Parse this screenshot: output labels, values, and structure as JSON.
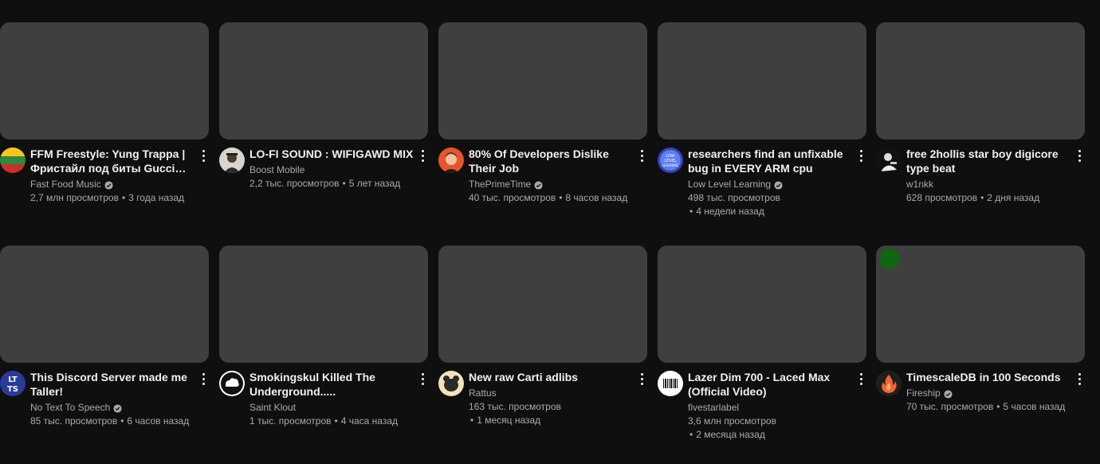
{
  "videos": [
    {
      "title": "FFM Freestyle: Yung Trappa | Фристайл под биты Gucci Man...",
      "channel": "Fast Food Music",
      "verified": true,
      "views": "2,7 млн просмотров",
      "age": "3 года назад",
      "avatar": "flag-stripes-avatar"
    },
    {
      "title": "LO-FI SOUND : WIFIGAWD MIX",
      "channel": "Boost Mobile",
      "verified": false,
      "views": "2,2 тыс. просмотров",
      "age": "5 лет назад",
      "avatar": "person-avatar"
    },
    {
      "title": "80% Of Developers Dislike Their Job",
      "channel": "ThePrimeTime",
      "verified": true,
      "views": "40 тыс. просмотров",
      "age": "8 часов назад",
      "avatar": "face-avatar"
    },
    {
      "title": "researchers find an unfixable bug in EVERY ARM cpu",
      "channel": "Low Level Learning",
      "verified": true,
      "views": "498 тыс. просмотров",
      "age": "4 недели назад",
      "avatar": "low-level-learning-avatar"
    },
    {
      "title": "free 2hollis star boy digicore type beat",
      "channel": "w1nkk",
      "verified": false,
      "views": "628 просмотров",
      "age": "2 дня назад",
      "avatar": "bw-person-avatar"
    },
    {
      "title": "This Discord Server made me Taller!",
      "channel": "No Text To Speech",
      "verified": true,
      "views": "85 тыс. просмотров",
      "age": "6 часов назад",
      "avatar": "ntts-avatar"
    },
    {
      "title": "Smokingskul Killed The Underground.....",
      "channel": "Saint Klout",
      "verified": false,
      "views": "1 тыс. просмотров",
      "age": "4 часа назад",
      "avatar": "cloud-avatar"
    },
    {
      "title": "New raw Carti adlibs",
      "channel": "Rattus",
      "verified": false,
      "views": "163 тыс. просмотров",
      "age": "1 месяц назад",
      "avatar": "rat-avatar"
    },
    {
      "title": "Lazer Dim 700 - Laced Max (Official Video)",
      "channel": "fivestarlabel",
      "verified": false,
      "views": "3,6 млн просмотров",
      "age": "2 месяца назад",
      "avatar": "barcode-avatar"
    },
    {
      "title": "TimescaleDB in 100 Seconds",
      "channel": "Fireship",
      "verified": true,
      "views": "70 тыс. просмотров",
      "age": "5 часов назад",
      "avatar": "fire-avatar"
    }
  ],
  "colors": {
    "background": "#0f0f0f",
    "thumbnail": "#3f3f3f",
    "text_primary": "#f1f1f1",
    "text_secondary": "#aaaaaa"
  }
}
